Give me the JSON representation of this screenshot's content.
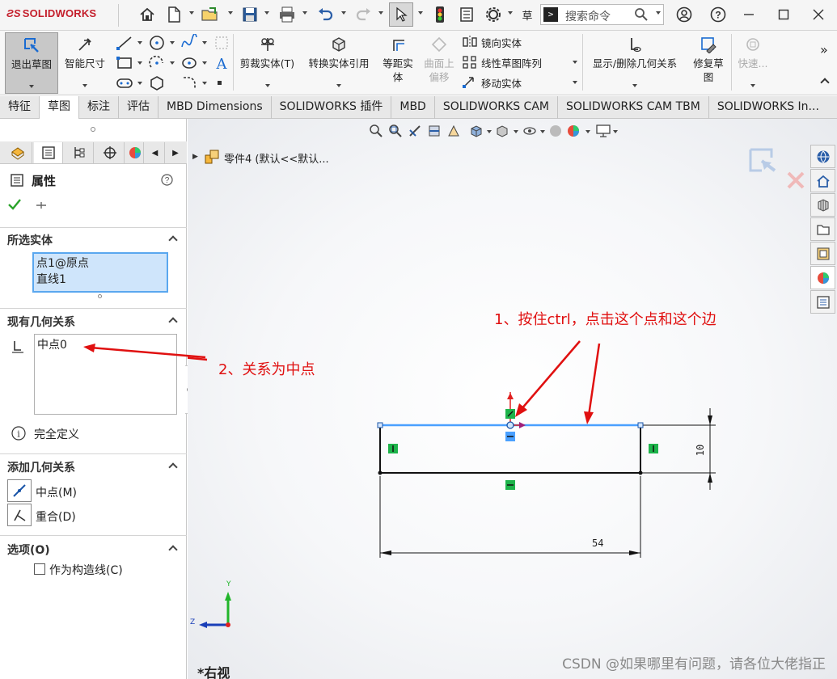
{
  "titlebar": {
    "brand": "SOLIDWORKS",
    "search_placeholder": "搜索命令"
  },
  "command_manager": {
    "exit_sketch": "退出草图",
    "smart_dimension": "智能尺寸",
    "trim_entities": "剪裁实体(T)",
    "convert_entities": "转换实体引用",
    "offset_entities": [
      "等距实",
      "体"
    ],
    "offset_on_surface": [
      "曲面上",
      "偏移"
    ],
    "mirror_entities": "镜向实体",
    "linear_pattern": "线性草图阵列",
    "move_entities": "移动实体",
    "display_relations": "显示/删除几何关系",
    "repair_sketch": [
      "修复草",
      "图"
    ],
    "quick_snaps": "快速..."
  },
  "tabs": [
    "特征",
    "草图",
    "标注",
    "评估",
    "MBD Dimensions",
    "SOLIDWORKS 插件",
    "MBD",
    "SOLIDWORKS CAM",
    "SOLIDWORKS CAM TBM",
    "SOLIDWORKS In..."
  ],
  "property_manager": {
    "title": "属性",
    "selected_entities_header": "所选实体",
    "selected_items": [
      "点1@原点",
      "直线1"
    ],
    "existing_relations_header": "现有几何关系",
    "existing_relations": [
      "中点0"
    ],
    "status": "完全定义",
    "add_relations_header": "添加几何关系",
    "add_relations": [
      {
        "label": "中点(M)"
      },
      {
        "label": "重合(D)"
      }
    ],
    "options_header": "选项(O)",
    "construction_checkbox": "作为构造线(C)"
  },
  "feature_tree": {
    "part_name": "零件4 (默认<<默认..."
  },
  "sketch": {
    "dim_width": "54",
    "dim_height": "10"
  },
  "annotations": {
    "step1": "1、按住ctrl，点击这个点和这个边",
    "step2": "2、关系为中点"
  },
  "view": {
    "orientation_label": "*右视",
    "axis_y": "Y",
    "axis_z": "Z"
  },
  "watermark": "CSDN @如果哪里有问题，请各位大佬指正",
  "colors": {
    "selection_blue": "#4aa0ff",
    "relation_green": "#1db34a",
    "annotation_red": "#e01010",
    "brand_red": "#c41e2b"
  }
}
